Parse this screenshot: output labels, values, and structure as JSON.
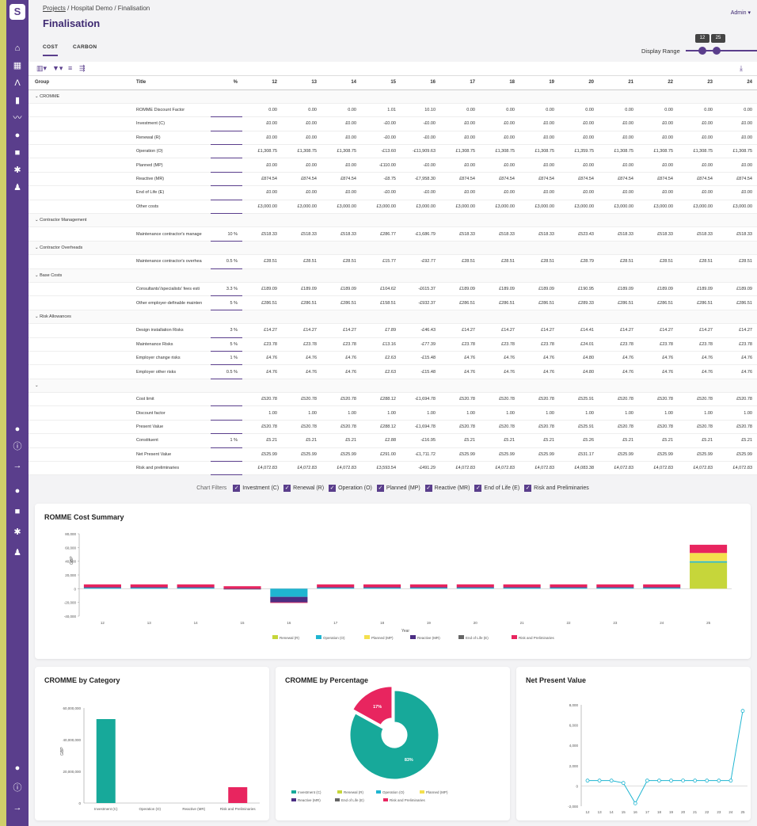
{
  "breadcrumb": {
    "projects": "Projects",
    "project": "Hospital Demo",
    "page": "Finalisation",
    "sep": "/"
  },
  "page_title": "Finalisation",
  "user_menu": "Admin",
  "tabs": [
    {
      "label": "COST",
      "active": true
    },
    {
      "label": "CARBON",
      "active": false
    }
  ],
  "display_range": {
    "label": "Display Range",
    "from": "12",
    "to": "25"
  },
  "table": {
    "headers": {
      "group": "Group",
      "title": "Title",
      "pct": "%"
    },
    "years": [
      "12",
      "13",
      "14",
      "15",
      "16",
      "17",
      "18",
      "19",
      "20",
      "21",
      "22",
      "23",
      "24"
    ],
    "rows": [
      {
        "type": "group",
        "label": "CROMME"
      },
      {
        "title": "ROMME Discount Factor",
        "pct": "",
        "values": [
          "0.00",
          "0.00",
          "0.00",
          "1.01",
          "10.10",
          "0.00",
          "0.00",
          "0.00",
          "0.00",
          "0.00",
          "0.00",
          "0.00",
          "0.00"
        ]
      },
      {
        "title": "Investment (C)",
        "pct": "",
        "values": [
          "£0.00",
          "£0.00",
          "£0.00",
          "-£0.00",
          "-£0.00",
          "£0.00",
          "£0.00",
          "£0.00",
          "£0.00",
          "£0.00",
          "£0.00",
          "£0.00",
          "£0.00"
        ]
      },
      {
        "title": "Renewal (R)",
        "pct": "",
        "values": [
          "£0.00",
          "£0.00",
          "£0.00",
          "-£0.00",
          "-£0.00",
          "£0.00",
          "£0.00",
          "£0.00",
          "£0.00",
          "£0.00",
          "£0.00",
          "£0.00",
          "£0.00"
        ]
      },
      {
        "title": "Operation (O)",
        "pct": "",
        "values": [
          "£1,308.75",
          "£1,308.75",
          "£1,308.75",
          "-£13.60",
          "-£11,909.63",
          "£1,308.75",
          "£1,308.75",
          "£1,308.75",
          "£1,359.75",
          "£1,308.75",
          "£1,308.75",
          "£1,308.75",
          "£1,308.75"
        ]
      },
      {
        "title": "Planned (MP)",
        "pct": "",
        "values": [
          "£0.00",
          "£0.00",
          "£0.00",
          "-£110.00",
          "-£0.00",
          "£0.00",
          "£0.00",
          "£0.00",
          "£0.00",
          "£0.00",
          "£0.00",
          "£0.00",
          "£0.00"
        ]
      },
      {
        "title": "Reactive (MR)",
        "pct": "",
        "values": [
          "£874.54",
          "£874.54",
          "£874.54",
          "-£8.75",
          "-£7,958.30",
          "£874.54",
          "£874.54",
          "£874.54",
          "£874.54",
          "£874.54",
          "£874.54",
          "£874.54",
          "£874.54"
        ]
      },
      {
        "title": "End of Life (E)",
        "pct": "",
        "values": [
          "£0.00",
          "£0.00",
          "£0.00",
          "-£0.00",
          "-£0.00",
          "£0.00",
          "£0.00",
          "£0.00",
          "£0.00",
          "£0.00",
          "£0.00",
          "£0.00",
          "£0.00"
        ]
      },
      {
        "title": "Other costs",
        "pct": "",
        "values": [
          "£3,000.00",
          "£3,000.00",
          "£3,000.00",
          "£3,000.00",
          "£3,000.00",
          "£3,000.00",
          "£3,000.00",
          "£3,000.00",
          "£3,000.00",
          "£3,000.00",
          "£3,000.00",
          "£3,000.00",
          "£3,000.00"
        ]
      },
      {
        "type": "group",
        "label": "Contractor Management"
      },
      {
        "title": "Maintenance contractor's manage",
        "pct": "10 %",
        "values": [
          "£518.33",
          "£518.33",
          "£518.33",
          "£286.77",
          "-£1,686.79",
          "£518.33",
          "£518.33",
          "£518.33",
          "£523.43",
          "£518.33",
          "£518.33",
          "£518.33",
          "£518.33"
        ]
      },
      {
        "type": "group",
        "label": "Contractor Overheads"
      },
      {
        "title": "Maintenance contractor's overhea",
        "pct": "0.5 %",
        "values": [
          "£28.51",
          "£28.51",
          "£28.51",
          "£15.77",
          "-£92.77",
          "£28.51",
          "£28.51",
          "£28.51",
          "£28.79",
          "£28.51",
          "£28.51",
          "£28.51",
          "£28.51"
        ]
      },
      {
        "type": "group",
        "label": "Base Costs"
      },
      {
        "title": "Consultants'/specialists' fees esti",
        "pct": "3.3 %",
        "values": [
          "£189.09",
          "£189.09",
          "£189.09",
          "£104.62",
          "-£615.37",
          "£189.09",
          "£189.09",
          "£189.09",
          "£190.95",
          "£189.09",
          "£189.09",
          "£189.09",
          "£189.09"
        ]
      },
      {
        "title": "Other employer-definable mainten",
        "pct": "5 %",
        "values": [
          "£286.51",
          "£286.51",
          "£286.51",
          "£158.51",
          "-£932.37",
          "£286.51",
          "£286.51",
          "£286.51",
          "£289.33",
          "£286.51",
          "£286.51",
          "£286.51",
          "£286.51"
        ]
      },
      {
        "type": "group",
        "label": "Risk Allowances"
      },
      {
        "title": "Design installation Risks",
        "pct": "3 %",
        "values": [
          "£14.27",
          "£14.27",
          "£14.27",
          "£7.89",
          "-£46.43",
          "£14.27",
          "£14.27",
          "£14.27",
          "£14.41",
          "£14.27",
          "£14.27",
          "£14.27",
          "£14.27"
        ]
      },
      {
        "title": "Maintenance Risks",
        "pct": "5 %",
        "values": [
          "£23.78",
          "£23.78",
          "£23.78",
          "£13.16",
          "-£77.39",
          "£23.78",
          "£23.78",
          "£23.78",
          "£24.01",
          "£23.78",
          "£23.78",
          "£23.78",
          "£23.78"
        ]
      },
      {
        "title": "Employer change risks",
        "pct": "1 %",
        "values": [
          "£4.76",
          "£4.76",
          "£4.76",
          "£2.63",
          "-£15.48",
          "£4.76",
          "£4.76",
          "£4.76",
          "£4.80",
          "£4.76",
          "£4.76",
          "£4.76",
          "£4.76"
        ]
      },
      {
        "title": "Employer other risks",
        "pct": "0.5 %",
        "values": [
          "£4.76",
          "£4.76",
          "£4.76",
          "£2.63",
          "-£15.48",
          "£4.76",
          "£4.76",
          "£4.76",
          "£4.80",
          "£4.76",
          "£4.76",
          "£4.76",
          "£4.76"
        ]
      },
      {
        "type": "group",
        "label": ""
      },
      {
        "title": "Cost limit",
        "pct": "",
        "values": [
          "£520.78",
          "£520.78",
          "£520.78",
          "£288.12",
          "-£1,694.78",
          "£520.78",
          "£520.78",
          "£520.78",
          "£525.91",
          "£520.78",
          "£520.78",
          "£520.78",
          "£520.78"
        ]
      },
      {
        "title": "Discount factor",
        "pct": "",
        "values": [
          "1.00",
          "1.00",
          "1.00",
          "1.00",
          "1.00",
          "1.00",
          "1.00",
          "1.00",
          "1.00",
          "1.00",
          "1.00",
          "1.00",
          "1.00"
        ]
      },
      {
        "title": "Present Value",
        "pct": "",
        "values": [
          "£520.78",
          "£520.78",
          "£520.78",
          "£288.12",
          "-£1,694.78",
          "£520.78",
          "£520.78",
          "£520.78",
          "£525.91",
          "£520.78",
          "£520.78",
          "£520.78",
          "£520.78"
        ]
      },
      {
        "title": "Constituent",
        "pct": "1 %",
        "values": [
          "£5.21",
          "£5.21",
          "£5.21",
          "£2.88",
          "-£16.95",
          "£5.21",
          "£5.21",
          "£5.21",
          "£5.26",
          "£5.21",
          "£5.21",
          "£5.21",
          "£5.21"
        ]
      },
      {
        "title": "Net Present Value",
        "pct": "",
        "values": [
          "£525.99",
          "£525.99",
          "£525.99",
          "£291.00",
          "-£1,711.72",
          "£525.99",
          "£525.99",
          "£525.99",
          "£531.17",
          "£525.99",
          "£525.99",
          "£525.99",
          "£525.99"
        ]
      },
      {
        "title": "Risk and preliminaries",
        "pct": "",
        "values": [
          "£4,072.83",
          "£4,072.83",
          "£4,072.83",
          "£3,593.54",
          "-£491.29",
          "£4,072.83",
          "£4,072.83",
          "£4,072.83",
          "£4,083.38",
          "£4,072.83",
          "£4,072.83",
          "£4,072.83",
          "£4,072.83"
        ]
      }
    ]
  },
  "chart_filters": {
    "label": "Chart Filters",
    "items": [
      "Investment (C)",
      "Renewal (R)",
      "Operation (O)",
      "Planned (MP)",
      "Reactive (MR)",
      "End of Life (E)",
      "Risk and Preliminaries"
    ]
  },
  "colors": {
    "purple": "#5a3e8c",
    "teal": "#17a99a",
    "lime": "#c6d63a",
    "cyan": "#1fb5d1",
    "yellow": "#f4e04d",
    "indigo": "#4b2e83",
    "grey": "#666666",
    "pink": "#e8255f"
  },
  "chart_data": [
    {
      "type": "bar",
      "title": "ROMME Cost Summary",
      "xlabel": "Year",
      "ylabel": "GBP",
      "ylim": [
        -40000,
        80000
      ],
      "yticks": [
        "80,000",
        "60,000",
        "40,000",
        "20,000",
        "0",
        "-20,000",
        "-40,000"
      ],
      "categories": [
        "12",
        "13",
        "14",
        "15",
        "16",
        "17",
        "18",
        "19",
        "20",
        "21",
        "22",
        "23",
        "24",
        "25"
      ],
      "series": [
        {
          "name": "Renewal (R)",
          "color": "#c6d63a",
          "values": [
            0,
            0,
            0,
            0,
            0,
            0,
            0,
            0,
            0,
            0,
            0,
            0,
            0,
            38000
          ]
        },
        {
          "name": "Operation (O)",
          "color": "#1fb5d1",
          "values": [
            1309,
            1309,
            1309,
            -14,
            -11910,
            1309,
            1309,
            1309,
            1360,
            1309,
            1309,
            1309,
            1309,
            2000
          ]
        },
        {
          "name": "Planned (MP)",
          "color": "#f4e04d",
          "values": [
            0,
            0,
            0,
            -110,
            0,
            0,
            0,
            0,
            0,
            0,
            0,
            0,
            0,
            12000
          ]
        },
        {
          "name": "Reactive (MR)",
          "color": "#4b2e83",
          "values": [
            875,
            875,
            875,
            -9,
            -7958,
            875,
            875,
            875,
            875,
            875,
            875,
            875,
            875,
            0
          ]
        },
        {
          "name": "End of Life (E)",
          "color": "#666666",
          "values": [
            0,
            0,
            0,
            0,
            0,
            0,
            0,
            0,
            0,
            0,
            0,
            0,
            0,
            0
          ]
        },
        {
          "name": "Risk and Preliminaries",
          "color": "#e8255f",
          "values": [
            4073,
            4073,
            4073,
            3594,
            -491,
            4073,
            4073,
            4073,
            4083,
            4073,
            4073,
            4073,
            4073,
            12000
          ]
        }
      ]
    },
    {
      "type": "bar",
      "title": "CROMME by Category",
      "ylabel": "GBP",
      "ylim": [
        0,
        60000000
      ],
      "yticks": [
        "60,000,000",
        "40,000,000",
        "20,000,000",
        "0"
      ],
      "categories": [
        "Investment (C)",
        "Operation (O)",
        "Reactive (MR)",
        "Risk and Preliminaries"
      ],
      "values": [
        53000000,
        0,
        0,
        10000000
      ],
      "colors": [
        "#17a99a",
        "#1fb5d1",
        "#4b2e83",
        "#e8255f"
      ]
    },
    {
      "type": "pie",
      "title": "CROMME by Percentage",
      "slices": [
        {
          "name": "Investment (C)",
          "value": 83,
          "label": "83%",
          "color": "#17a99a"
        },
        {
          "name": "Risk and Preliminaries",
          "value": 17,
          "label": "17%",
          "color": "#e8255f"
        }
      ],
      "legend": [
        "Investment (C)",
        "Renewal (R)",
        "Operation (O)",
        "Planned (MP)",
        "Reactive (MR)",
        "End of Life (E)",
        "Risk and Preliminaries"
      ],
      "legend_colors": [
        "#17a99a",
        "#c6d63a",
        "#1fb5d1",
        "#f4e04d",
        "#4b2e83",
        "#666666",
        "#e8255f"
      ]
    },
    {
      "type": "line",
      "title": "Net Present Value",
      "ylim": [
        -2000,
        8000
      ],
      "yticks": [
        "8,000",
        "6,000",
        "4,000",
        "2,000",
        "0",
        "-2,000"
      ],
      "x": [
        "12",
        "13",
        "14",
        "15",
        "16",
        "17",
        "18",
        "19",
        "20",
        "21",
        "22",
        "23",
        "24",
        "25"
      ],
      "values": [
        526,
        526,
        526,
        291,
        -1712,
        526,
        526,
        526,
        531,
        526,
        526,
        526,
        526,
        7400
      ],
      "color": "#1fb5d1"
    }
  ],
  "sidebar_icons": [
    "home-icon",
    "dashboard-icon",
    "chevron-icon",
    "clipboard-icon",
    "trend-icon",
    "globe-icon",
    "book-icon",
    "gear-icon",
    "user-icon"
  ],
  "sidebar_bottom_icons": [
    "help-icon",
    "info-icon",
    "arrow-icon"
  ]
}
